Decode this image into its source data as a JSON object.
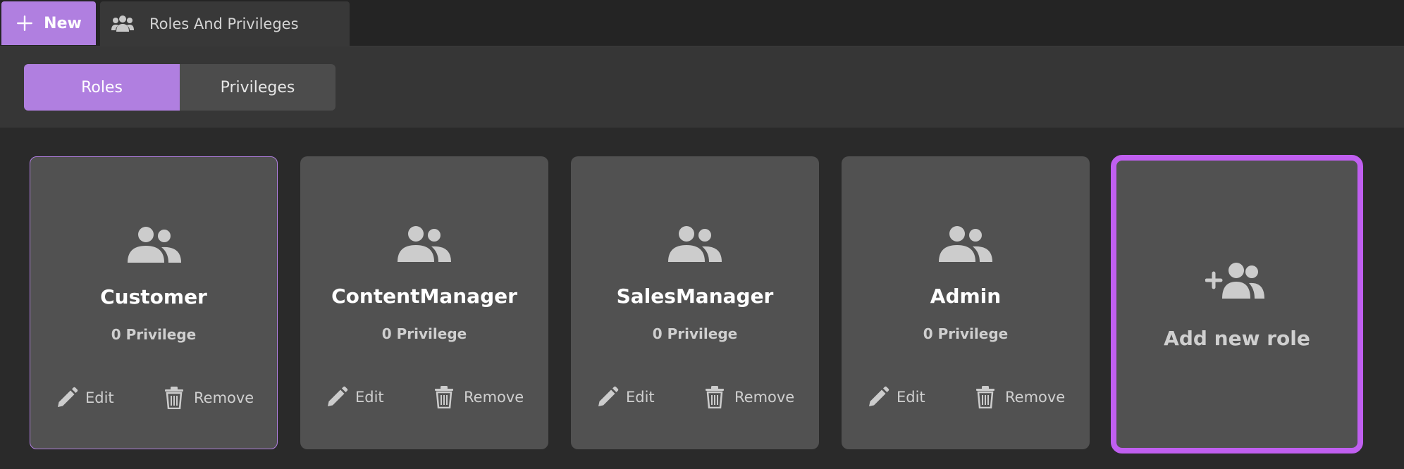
{
  "topbar": {
    "new_label": "New",
    "tab_title": "Roles And Privileges",
    "tab_icon": "users-icon"
  },
  "toolbar": {
    "segments": [
      {
        "label": "Roles",
        "active": true
      },
      {
        "label": "Privileges",
        "active": false
      }
    ]
  },
  "roles": [
    {
      "name": "Customer",
      "privileges": "0 Privilege",
      "selected": true
    },
    {
      "name": "ContentManager",
      "privileges": "0 Privilege",
      "selected": false
    },
    {
      "name": "SalesManager",
      "privileges": "0 Privilege",
      "selected": false
    },
    {
      "name": "Admin",
      "privileges": "0 Privilege",
      "selected": false
    }
  ],
  "card_actions": {
    "edit_label": "Edit",
    "remove_label": "Remove"
  },
  "add_card": {
    "label": "Add new role",
    "icon": "add-user-icon"
  },
  "colors": {
    "accent": "#b07fe0",
    "add_card_border": "#c05ff0",
    "card_bg": "#515151",
    "page_bg": "#2a2a2a"
  }
}
